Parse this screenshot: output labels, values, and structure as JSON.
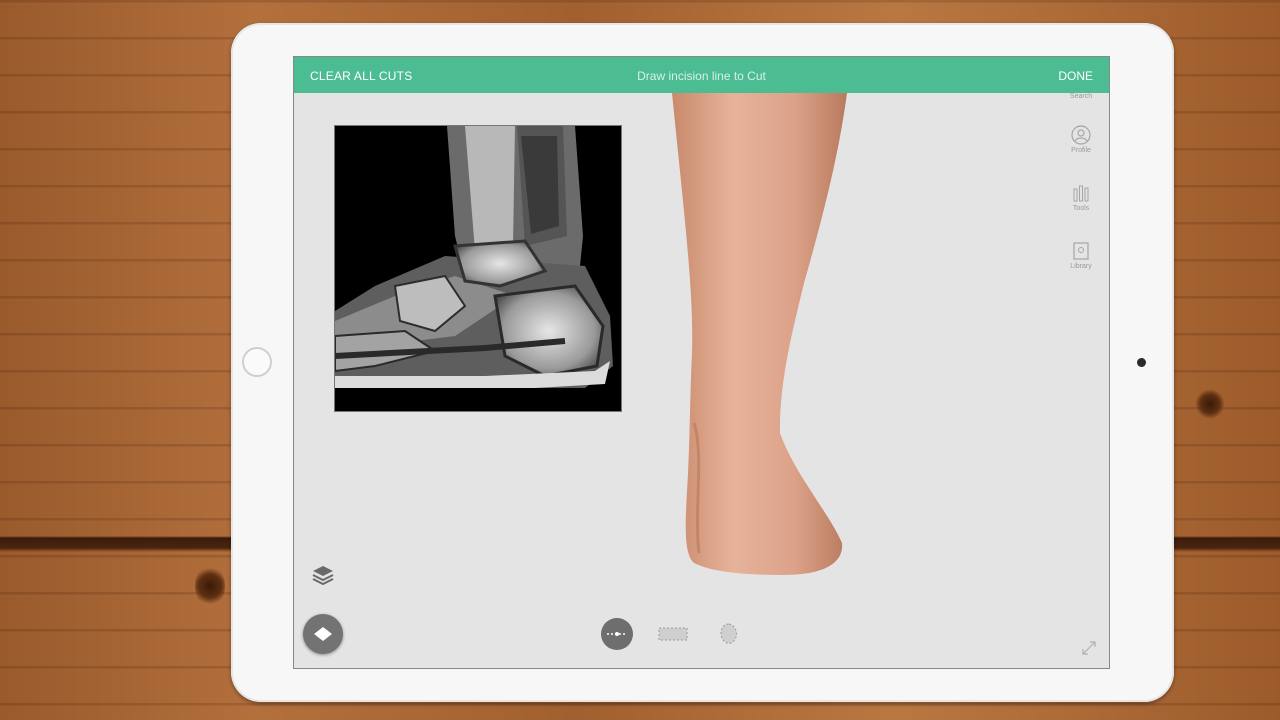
{
  "toolbar": {
    "clear_label": "CLEAR ALL CUTS",
    "instruction": "Draw incision line to Cut",
    "done_label": "DONE",
    "accent_color": "#4cbc93"
  },
  "side_tools": [
    {
      "label": "Search",
      "icon": "search-icon"
    },
    {
      "label": "Profile",
      "icon": "profile-icon"
    },
    {
      "label": "Tools",
      "icon": "tools-icon"
    },
    {
      "label": "Library",
      "icon": "library-icon"
    }
  ],
  "bottom_left": {
    "layers_icon": "layers-icon",
    "view_icon": "diamond-view-icon"
  },
  "cut_tools": [
    {
      "name": "line-cut-icon",
      "selected": true
    },
    {
      "name": "rectangle-cut-icon",
      "selected": false
    },
    {
      "name": "freeform-cut-icon",
      "selected": false
    }
  ],
  "viewer": {
    "image_subject": "MRI sagittal ankle",
    "model_subject": "3D lower leg and foot"
  }
}
